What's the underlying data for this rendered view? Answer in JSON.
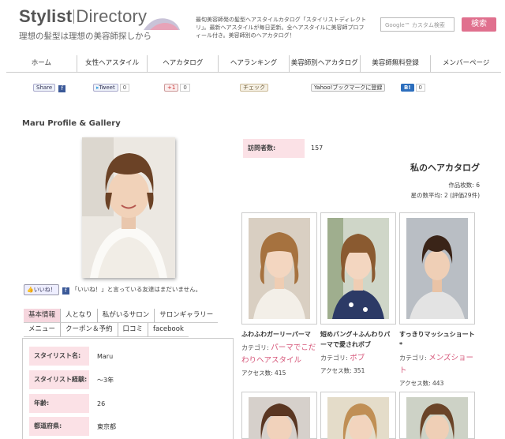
{
  "header": {
    "logo_a": "Stylist",
    "logo_b": "Directory",
    "tagline": "理想の髪型は理想の美容師探しから",
    "description": "最旬美容師発の髪型ヘアスタイルカタログ「スタイリストディレクトリ」。最新ヘアスタイルが毎日更新。全ヘアスタイルに美容師プロフィール付き。美容師別のヘアカタログ！",
    "search_placeholder": "Google™ カスタム検索",
    "search_button": "検索"
  },
  "nav": [
    "ホーム",
    "女性ヘアスタイル",
    "ヘアカタログ",
    "ヘアランキング",
    "美容師別ヘアカタログ",
    "美容師無料登録",
    "メンバーページ"
  ],
  "social": {
    "share": "Share",
    "tweet": "Tweet",
    "tweet_count": "0",
    "gplus": "+1",
    "gplus_count": "0",
    "mixi": "チェック",
    "yahoo": "Yahoo!ブックマークに登録",
    "hatena": "B!",
    "hatena_count": "0"
  },
  "profile": {
    "section_title": "Maru Profile & Gallery",
    "like_label": "いいね！",
    "like_text": "「いいね！」と言っている友達はまだいません。",
    "tabs_row1": [
      "基本情報",
      "人となり",
      "私がいるサロン",
      "サロンギャラリー"
    ],
    "tabs_row2": [
      "メニュー",
      "クーポン＆予約",
      "口コミ",
      "facebook"
    ],
    "info": [
      {
        "label": "スタイリスト名:",
        "value": "Maru"
      },
      {
        "label": "スタイリスト経験:",
        "value": "〜3年"
      },
      {
        "label": "年齢:",
        "value": "26"
      },
      {
        "label": "都道府県:",
        "value": "東京都"
      }
    ]
  },
  "catalog": {
    "visits_label": "訪問者数:",
    "visits_value": "157",
    "title": "私のヘアカタログ",
    "works": "作品枚数: 6",
    "rating": "星の数平均: 2 (評価29件)",
    "items": [
      {
        "title": "ふわふわガーリーパーマ",
        "cat_prefix": "カテゴリ: ",
        "category": "パーマでこだわりヘアスタイル",
        "access": "アクセス数: 415"
      },
      {
        "title": "短めバング＋ふんわりパーマで愛されボブ",
        "cat_prefix": "カテゴリ: ",
        "category": "ボブ",
        "access": "アクセス数: 351"
      },
      {
        "title": "すっきりマッシュショート*",
        "cat_prefix": "カテゴリ: ",
        "category": "メンズショート",
        "access": "アクセス数: 443"
      }
    ]
  }
}
